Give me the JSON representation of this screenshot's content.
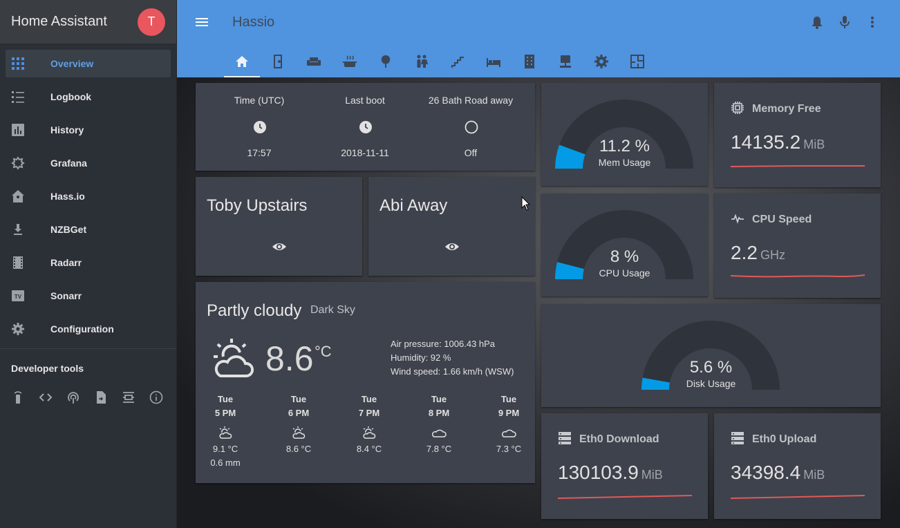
{
  "sidebar": {
    "title": "Home Assistant",
    "avatar_initial": "T",
    "items": [
      {
        "label": "Overview",
        "icon": "apps-icon"
      },
      {
        "label": "Logbook",
        "icon": "list-icon"
      },
      {
        "label": "History",
        "icon": "chart-bar-icon"
      },
      {
        "label": "Grafana",
        "icon": "grafana-icon"
      },
      {
        "label": "Hass.io",
        "icon": "home-assistant-icon"
      },
      {
        "label": "NZBGet",
        "icon": "download-icon"
      },
      {
        "label": "Radarr",
        "icon": "film-icon"
      },
      {
        "label": "Sonarr",
        "icon": "tv-icon"
      },
      {
        "label": "Configuration",
        "icon": "gear-icon"
      }
    ],
    "developer_tools_title": "Developer tools",
    "developer_tools": [
      "remote-icon",
      "code-icon",
      "podcast-icon",
      "file-import-icon",
      "timeline-icon",
      "info-icon"
    ]
  },
  "header": {
    "title": "Hassio",
    "actions": [
      "bell-icon",
      "microphone-icon",
      "more-vertical-icon"
    ],
    "tabs": [
      "home-icon",
      "door-icon",
      "sofa-icon",
      "pot-steam-icon",
      "tree-icon",
      "people-icon",
      "stairs-icon",
      "bed-icon",
      "building-icon",
      "desk-icon",
      "gear-icon",
      "floor-plan-icon"
    ],
    "active_tab": 0
  },
  "system_card": {
    "entities": [
      {
        "name": "Time (UTC)",
        "state": "17:57",
        "icon": "clock-icon"
      },
      {
        "name": "Last boot",
        "state": "2018-11-11",
        "icon": "clock-icon"
      },
      {
        "name": "26 Bath Road away",
        "state": "Off",
        "icon": "circle-outline-icon"
      }
    ]
  },
  "presence": [
    {
      "name": "Toby Upstairs",
      "icon": "eye-icon"
    },
    {
      "name": "Abi Away",
      "icon": "eye-icon"
    }
  ],
  "weather": {
    "condition": "Partly cloudy",
    "provider": "Dark Sky",
    "temperature": "8.6",
    "unit": "°C",
    "attributes": [
      "Air pressure: 1006.43 hPa",
      "Humidity: 92 %",
      "Wind speed: 1.66 km/h (WSW)"
    ],
    "forecast": [
      {
        "day": "Tue",
        "time": "5 PM",
        "icon": "partly-cloudy-icon",
        "temp": "9.1 °C",
        "precip": "0.6 mm"
      },
      {
        "day": "Tue",
        "time": "6 PM",
        "icon": "partly-cloudy-icon",
        "temp": "8.6 °C",
        "precip": ""
      },
      {
        "day": "Tue",
        "time": "7 PM",
        "icon": "partly-cloudy-icon",
        "temp": "8.4 °C",
        "precip": ""
      },
      {
        "day": "Tue",
        "time": "8 PM",
        "icon": "cloudy-icon",
        "temp": "7.8 °C",
        "precip": ""
      },
      {
        "day": "Tue",
        "time": "9 PM",
        "icon": "cloudy-icon",
        "temp": "7.3 °C",
        "precip": ""
      }
    ]
  },
  "gauges": [
    {
      "value_text": "11.2 %",
      "label": "Mem Usage",
      "percent": 11.2
    },
    {
      "value_text": "8 %",
      "label": "CPU Usage",
      "percent": 8
    },
    {
      "value_text": "5.6 %",
      "label": "Disk Usage",
      "percent": 5.6
    }
  ],
  "sensors": [
    {
      "name": "Memory Free",
      "value": "14135.2",
      "unit": "MiB",
      "icon": "chip-icon"
    },
    {
      "name": "CPU Speed",
      "value": "2.2",
      "unit": "GHz",
      "icon": "pulse-icon"
    },
    {
      "name": "Eth0 Download",
      "value": "130103.9",
      "unit": "MiB",
      "icon": "server-icon"
    },
    {
      "name": "Eth0 Upload",
      "value": "34398.4",
      "unit": "MiB",
      "icon": "server-icon"
    }
  ],
  "colors": {
    "accent": "#5093de",
    "gauge_fill": "#039be5",
    "gauge_track": "#2f333b",
    "sparkline": "#e05a5a",
    "avatar": "#e9565d"
  }
}
